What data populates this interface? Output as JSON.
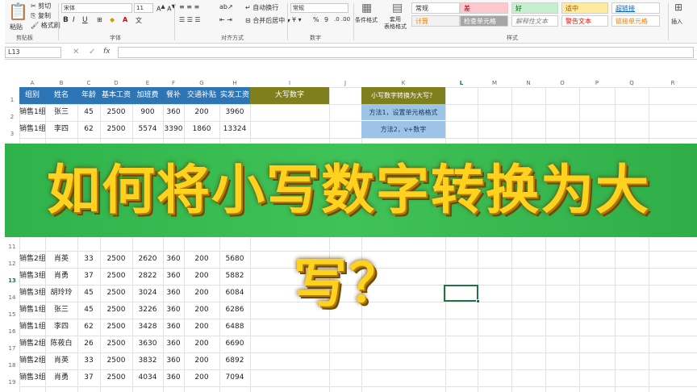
{
  "ribbon": {
    "paste": "粘贴",
    "cut": "剪切",
    "copy": "复制",
    "format_painter": "格式刷",
    "clipboard_label": "剪贴板",
    "font_name": "宋体",
    "font_size": "11",
    "font_label": "字体",
    "wrap_text": "自动换行",
    "merge_center": "合并后居中",
    "alignment_label": "对齐方式",
    "number_format": "常规",
    "percent": "%",
    "comma": "9",
    "number_label": "数字",
    "conditional_format": "条件格式",
    "table_format": "套用\n表格格式",
    "styles_label": "样式",
    "insert": "插入",
    "styles": [
      {
        "label": "常规",
        "bg": "#ffffff",
        "fg": "#333333"
      },
      {
        "label": "差",
        "bg": "#ffc7ce",
        "fg": "#9c0006"
      },
      {
        "label": "好",
        "bg": "#c6efce",
        "fg": "#006100"
      },
      {
        "label": "适中",
        "bg": "#ffeb9c",
        "fg": "#9c5700"
      },
      {
        "label": "超链接",
        "bg": "#ffffff",
        "fg": "#0563c1"
      },
      {
        "label": "计算",
        "bg": "#f2f2f2",
        "fg": "#fa7d00"
      },
      {
        "label": "检查单元格",
        "bg": "#a5a5a5",
        "fg": "#ffffff"
      },
      {
        "label": "解释性文本",
        "bg": "#ffffff",
        "fg": "#7f7f7f"
      },
      {
        "label": "警告文本",
        "bg": "#ffffff",
        "fg": "#ff0000"
      },
      {
        "label": "链接单元格",
        "bg": "#ffffff",
        "fg": "#fa7d00"
      }
    ]
  },
  "formula_bar": {
    "name_box": "L13",
    "fx": "fx"
  },
  "columns": [
    "A",
    "B",
    "C",
    "D",
    "E",
    "F",
    "G",
    "H",
    "I",
    "J",
    "K",
    "L",
    "M",
    "N",
    "O",
    "P",
    "Q",
    "R"
  ],
  "rows_visible": [
    "1",
    "2",
    "3",
    "11",
    "12",
    "13",
    "14",
    "15",
    "16",
    "17",
    "18",
    "19"
  ],
  "table": {
    "headers": [
      "组别",
      "姓名",
      "年龄",
      "基本工资",
      "加班费",
      "餐补",
      "交通补贴",
      "实发工资"
    ],
    "top_rows": [
      [
        "销售1组",
        "张三",
        "45",
        "2500",
        "900",
        "360",
        "200",
        "3960"
      ],
      [
        "销售1组",
        "李四",
        "62",
        "2500",
        "5574",
        "3390",
        "1860",
        "13324"
      ]
    ],
    "bottom_rows": [
      [
        "销售2组",
        "肖英",
        "33",
        "2500",
        "2620",
        "360",
        "200",
        "5680"
      ],
      [
        "销售3组",
        "肖勇",
        "37",
        "2500",
        "2822",
        "360",
        "200",
        "5882"
      ],
      [
        "销售3组",
        "胡玲玲",
        "45",
        "2500",
        "3024",
        "360",
        "200",
        "6084"
      ],
      [
        "销售1组",
        "张三",
        "45",
        "2500",
        "3226",
        "360",
        "200",
        "6286"
      ],
      [
        "销售1组",
        "李四",
        "62",
        "2500",
        "3428",
        "360",
        "200",
        "6488"
      ],
      [
        "销售2组",
        "陈莜白",
        "26",
        "2500",
        "3630",
        "360",
        "200",
        "6690"
      ],
      [
        "销售2组",
        "肖英",
        "33",
        "2500",
        "3832",
        "360",
        "200",
        "6892"
      ],
      [
        "销售3组",
        "肖勇",
        "37",
        "2500",
        "4034",
        "360",
        "200",
        "7094"
      ]
    ]
  },
  "side": {
    "daxie_header": "大写数字",
    "question": "小写数字转换为大写？",
    "method1": "方法1，设置单元格格式",
    "method2": "方法2，v+数字"
  },
  "banner": {
    "title": "如何将小写数字转换为大写？"
  }
}
